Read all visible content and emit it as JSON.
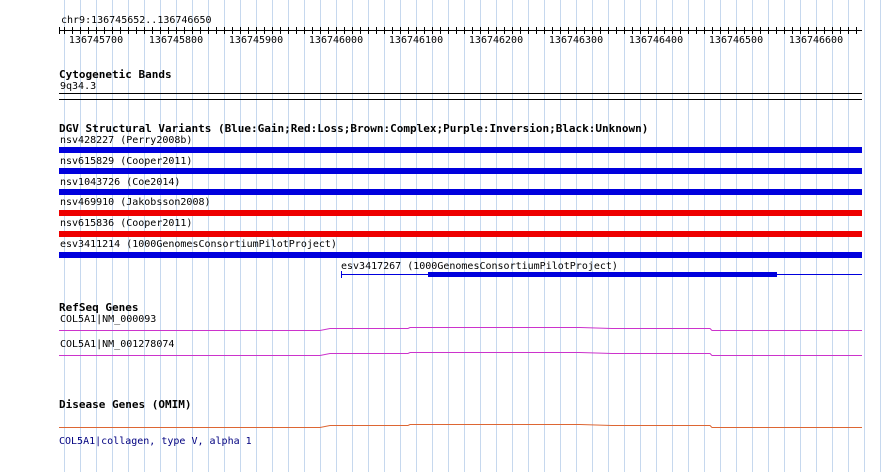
{
  "ruler": {
    "locus": "chr9:136745652..136746650",
    "ticks": [
      "136745700",
      "136745800",
      "136745900",
      "136746000",
      "136746100",
      "136746200",
      "136746300",
      "136746400",
      "136746500",
      "136746600"
    ]
  },
  "cytoband": {
    "title": "Cytogenetic Bands",
    "band": "9q34.3"
  },
  "dgv": {
    "title": "DGV Structural Variants (Blue:Gain;Red:Loss;Brown:Complex;Purple:Inversion;Black:Unknown)",
    "colors": {
      "gain": "#0000dd",
      "loss": "#ee0000"
    },
    "variants": [
      {
        "label": "nsv428227 (Perry2008b)",
        "type": "gain"
      },
      {
        "label": "nsv615829 (Cooper2011)",
        "type": "gain"
      },
      {
        "label": "nsv1043726 (Coe2014)",
        "type": "gain"
      },
      {
        "label": "nsv469910 (Jakobsson2008)",
        "type": "loss"
      },
      {
        "label": "nsv615836 (Cooper2011)",
        "type": "loss"
      },
      {
        "label": "esv3411214 (1000GenomesConsortiumPilotProject)",
        "type": "gain"
      }
    ],
    "partial": {
      "label": "esv3417267 (1000GenomesConsortiumPilotProject)",
      "type": "gain"
    }
  },
  "refseq": {
    "title": "RefSeq Genes",
    "color": "#cc33cc",
    "genes": [
      {
        "label": "COL5A1|NM_000093"
      },
      {
        "label": "COL5A1|NM_001278074"
      }
    ]
  },
  "omim": {
    "title": "Disease Genes (OMIM)",
    "color": "#dd6633",
    "gene": {
      "label": "COL5A1|collagen, type V, alpha 1"
    }
  }
}
